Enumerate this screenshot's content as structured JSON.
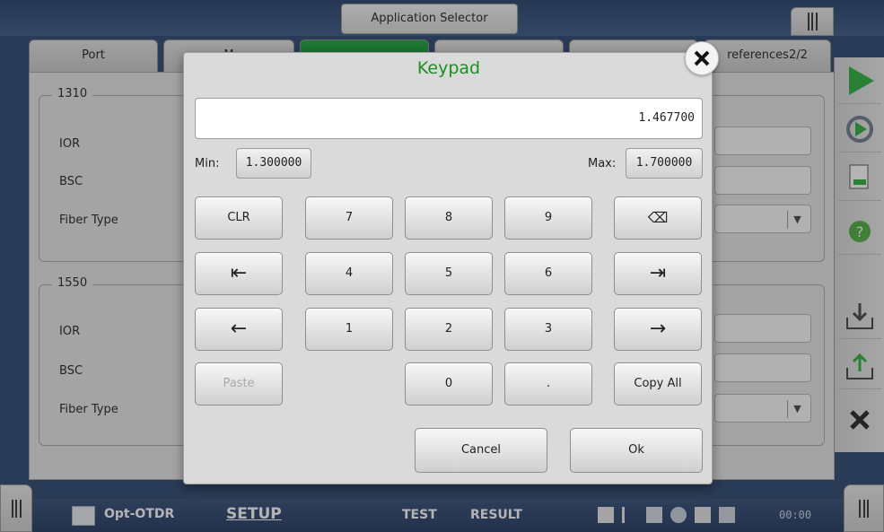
{
  "header": {
    "app_selector": "Application Selector"
  },
  "tabs": [
    {
      "label": "Port"
    },
    {
      "label": "M"
    },
    {
      "label": ""
    },
    {
      "label": ""
    },
    {
      "label": ""
    },
    {
      "label": "references2/2"
    }
  ],
  "groups": [
    {
      "title": "1310",
      "rows": [
        "IOR",
        "BSC",
        "Fiber Type"
      ]
    },
    {
      "title": "1550",
      "rows": [
        "IOR",
        "BSC",
        "Fiber Type"
      ]
    }
  ],
  "keypad": {
    "title": "Keypad",
    "display_value": "1.467700",
    "min_label": "Min:",
    "min_value": "1.300000",
    "max_label": "Max:",
    "max_value": "1.700000",
    "keys": {
      "clr": "CLR",
      "k7": "7",
      "k8": "8",
      "k9": "9",
      "backspace": "⌫",
      "home": "⇤",
      "k4": "4",
      "k5": "5",
      "k6": "6",
      "end": "⇥",
      "left": "←",
      "k1": "1",
      "k2": "2",
      "k3": "3",
      "right": "→",
      "paste": "Paste",
      "k0": "0",
      "dot": ".",
      "copy_all": "Copy All"
    },
    "cancel": "Cancel",
    "ok": "Ok"
  },
  "bottom_bar": {
    "app_name": "Opt-OTDR",
    "nav": {
      "setup": "SETUP",
      "test": "TEST",
      "result": "RESULT"
    },
    "time": "00:00"
  },
  "colors": {
    "accent_green": "#1b8f21",
    "active_tab": "#129a34",
    "bottom_bar": "#203660"
  }
}
